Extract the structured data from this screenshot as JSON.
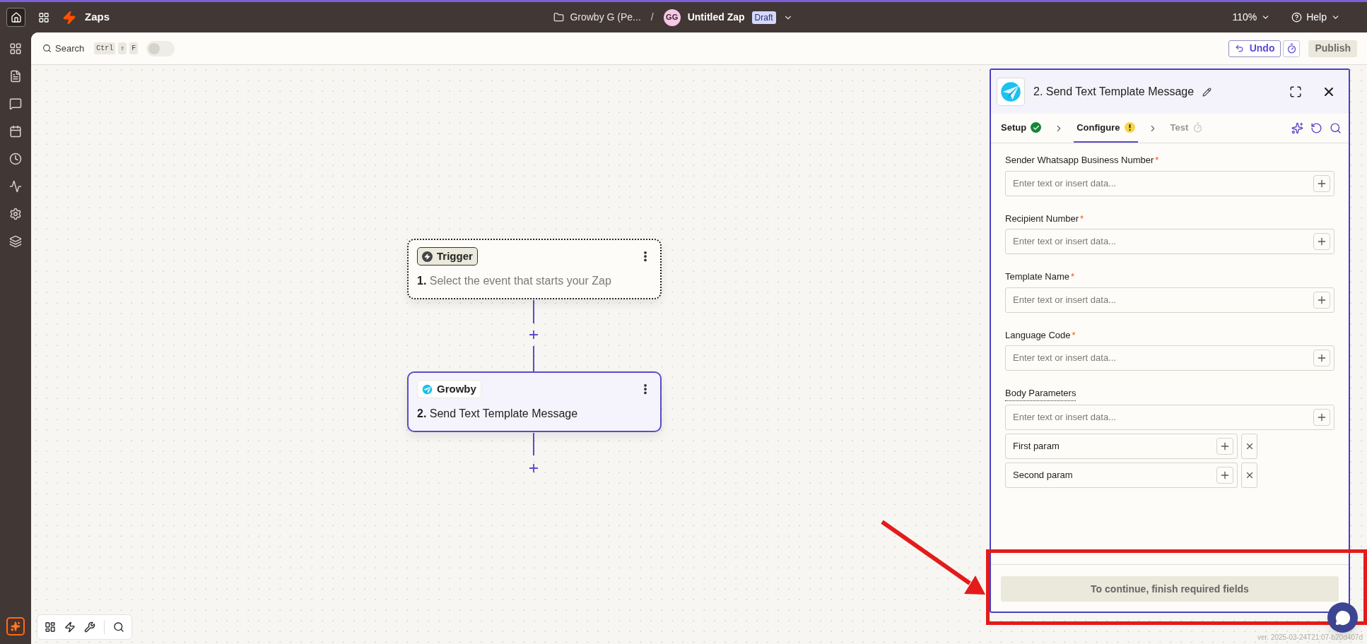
{
  "top_bar": {
    "app_title": "Zaps",
    "folder": "Growby G (Pe...",
    "separator": "/",
    "avatar_initials": "GG",
    "zap_title": "Untitled Zap",
    "status_badge": "Draft",
    "zoom": "110%",
    "help": "Help"
  },
  "toolbar": {
    "search_label": "Search",
    "shortcut_keys": [
      "Ctrl",
      "⇧",
      "F"
    ],
    "toggle_on": false,
    "undo": "Undo",
    "publish": "Publish"
  },
  "steps": [
    {
      "kind": "trigger",
      "app_label": "Trigger",
      "number": "1.",
      "title": "Select the event that starts your Zap",
      "selected": false
    },
    {
      "kind": "action",
      "app_label": "Growby",
      "number": "2.",
      "title": "Send Text Template Message",
      "selected": true
    }
  ],
  "panel": {
    "title": "2. Send Text Template Message",
    "tabs": [
      {
        "label": "Setup",
        "kind": "done",
        "selected": false
      },
      {
        "label": "Configure",
        "kind": "warning",
        "selected": true
      },
      {
        "label": "Test",
        "kind": "pending",
        "selected": false
      }
    ],
    "fields": [
      {
        "kind": "single",
        "label": "Sender Whatsapp Business Number",
        "required_mark": "*",
        "placeholder": "Enter text or insert data..."
      },
      {
        "kind": "single",
        "label": "Recipient Number",
        "required_mark": "*",
        "placeholder": "Enter text or insert data..."
      },
      {
        "kind": "single",
        "label": "Template Name",
        "required_mark": "*",
        "placeholder": "Enter text or insert data..."
      },
      {
        "kind": "single",
        "label": "Language Code",
        "required_mark": "*",
        "placeholder": "Enter text or insert data..."
      },
      {
        "kind": "list",
        "label": "Body Parameters",
        "placeholder": "Enter text or insert data...",
        "items": [
          "First param",
          "Second param"
        ]
      }
    ],
    "continue_button": "To continue, finish required fields"
  },
  "version": "ver. 2025-03-24T21:07-b20d407d"
}
